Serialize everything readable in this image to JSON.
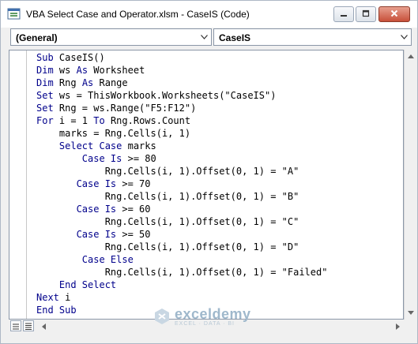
{
  "window": {
    "title": "VBA Select Case and Operator.xlsm - CaseIS (Code)"
  },
  "controls": {
    "minimize_icon": "minimize-icon",
    "restore_icon": "restore-icon",
    "close_icon": "close-icon"
  },
  "dropdowns": {
    "object": {
      "value": "(General)"
    },
    "procedure": {
      "value": "CaseIS"
    }
  },
  "code_lines": [
    [
      {
        "t": "Sub ",
        "k": true
      },
      {
        "t": "CaseIS()"
      }
    ],
    [
      {
        "t": "Dim ",
        "k": true
      },
      {
        "t": "ws "
      },
      {
        "t": "As ",
        "k": true
      },
      {
        "t": "Worksheet"
      }
    ],
    [
      {
        "t": "Dim ",
        "k": true
      },
      {
        "t": "Rng "
      },
      {
        "t": "As ",
        "k": true
      },
      {
        "t": "Range"
      }
    ],
    [
      {
        "t": "Set ",
        "k": true
      },
      {
        "t": "ws = ThisWorkbook.Worksheets(\"CaseIS\")"
      }
    ],
    [
      {
        "t": "Set ",
        "k": true
      },
      {
        "t": "Rng = ws.Range(\"F5:F12\")"
      }
    ],
    [
      {
        "t": "For ",
        "k": true
      },
      {
        "t": "i = 1 "
      },
      {
        "t": "To ",
        "k": true
      },
      {
        "t": "Rng.Rows.Count"
      }
    ],
    [
      {
        "t": "    marks = Rng.Cells(i, 1)"
      }
    ],
    [
      {
        "t": "    "
      },
      {
        "t": "Select Case ",
        "k": true
      },
      {
        "t": "marks"
      }
    ],
    [
      {
        "t": "        "
      },
      {
        "t": "Case Is ",
        "k": true
      },
      {
        "t": ">= 80"
      }
    ],
    [
      {
        "t": "            Rng.Cells(i, 1).Offset(0, 1) = \"A\""
      }
    ],
    [
      {
        "t": "       "
      },
      {
        "t": "Case Is ",
        "k": true
      },
      {
        "t": ">= 70"
      }
    ],
    [
      {
        "t": "            Rng.Cells(i, 1).Offset(0, 1) = \"B\""
      }
    ],
    [
      {
        "t": "       "
      },
      {
        "t": "Case Is ",
        "k": true
      },
      {
        "t": ">= 60"
      }
    ],
    [
      {
        "t": "            Rng.Cells(i, 1).Offset(0, 1) = \"C\""
      }
    ],
    [
      {
        "t": "       "
      },
      {
        "t": "Case Is ",
        "k": true
      },
      {
        "t": ">= 50"
      }
    ],
    [
      {
        "t": "            Rng.Cells(i, 1).Offset(0, 1) = \"D\""
      }
    ],
    [
      {
        "t": "        "
      },
      {
        "t": "Case Else",
        "k": true
      }
    ],
    [
      {
        "t": "            Rng.Cells(i, 1).Offset(0, 1) = \"Failed\""
      }
    ],
    [
      {
        "t": "    "
      },
      {
        "t": "End Select",
        "k": true
      }
    ],
    [
      {
        "t": "Next ",
        "k": true
      },
      {
        "t": "i"
      }
    ],
    [
      {
        "t": "End Sub",
        "k": true
      }
    ]
  ],
  "watermark": {
    "name": "exceldemy",
    "tagline": "EXCEL · DATA · BI"
  },
  "colors": {
    "keyword": "#00008b",
    "text": "#000000",
    "close_button": "#c7503a"
  }
}
